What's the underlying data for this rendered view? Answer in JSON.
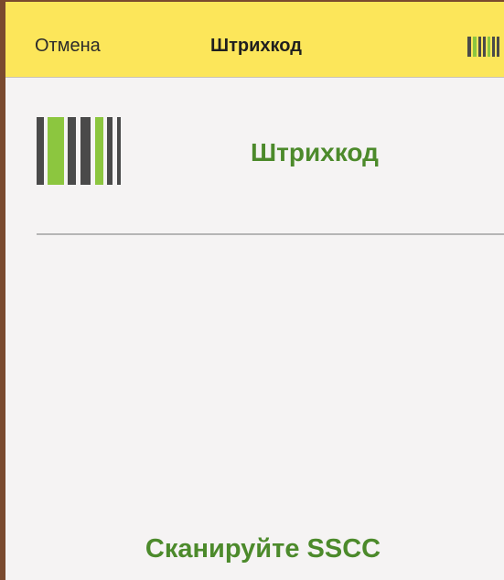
{
  "header": {
    "cancel_label": "Отмена",
    "title": "Штрихкод",
    "scan_icon": "barcode-icon"
  },
  "main": {
    "barcode_icon": "barcode-icon",
    "heading": "Штрихкод",
    "prompt": "Сканируйте SSCC"
  },
  "colors": {
    "header_bg": "#fce65a",
    "accent_green": "#4c8a2b",
    "bar_light_green": "#8cc63f",
    "bar_dark": "#4a4a4a",
    "page_bg": "#f5f3f3"
  }
}
